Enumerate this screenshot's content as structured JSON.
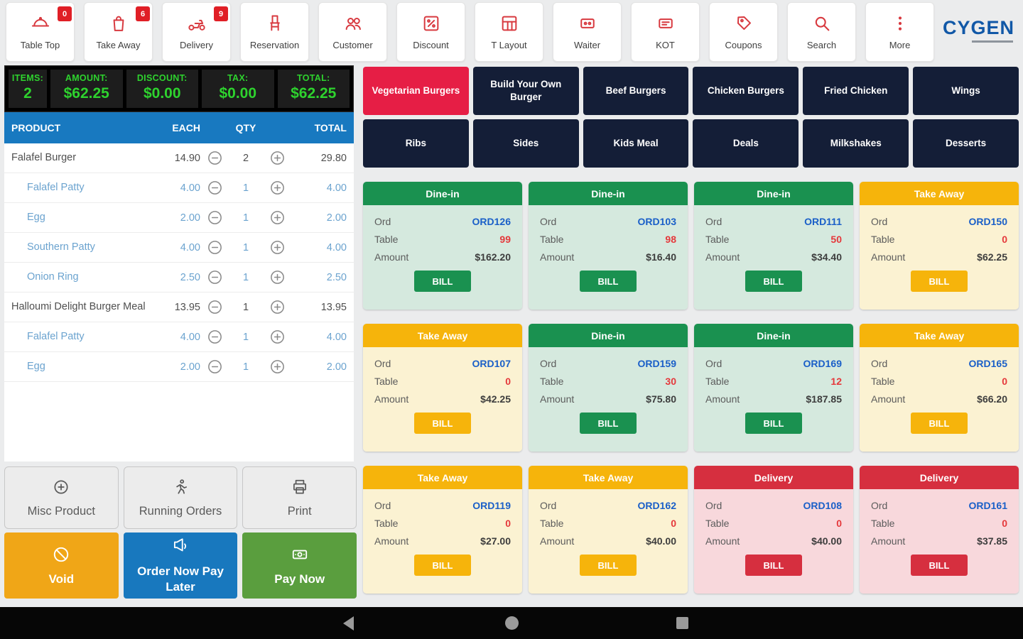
{
  "toolbar": {
    "brand": "CYGEN",
    "items": [
      {
        "label": "Table Top",
        "icon": "cloche-icon",
        "badge": "0"
      },
      {
        "label": "Take Away",
        "icon": "bag-icon",
        "badge": "6"
      },
      {
        "label": "Delivery",
        "icon": "scooter-icon",
        "badge": "9"
      },
      {
        "label": "Reservation",
        "icon": "chair-icon"
      },
      {
        "label": "Customer",
        "icon": "customers-icon"
      },
      {
        "label": "Discount",
        "icon": "discount-icon"
      },
      {
        "label": "T Layout",
        "icon": "table-layout-icon"
      },
      {
        "label": "Waiter",
        "icon": "waiter-pad-icon"
      },
      {
        "label": "KOT",
        "icon": "kot-ticket-icon"
      },
      {
        "label": "Coupons",
        "icon": "coupon-tag-icon"
      },
      {
        "label": "Search",
        "icon": "search-icon"
      },
      {
        "label": "More",
        "icon": "more-dots-icon"
      }
    ]
  },
  "summary": {
    "items": [
      {
        "label": "ITEMS:",
        "value": "2"
      },
      {
        "label": "AMOUNT:",
        "value": "$62.25"
      },
      {
        "label": "DISCOUNT:",
        "value": "$0.00"
      },
      {
        "label": "TAX:",
        "value": "$0.00"
      },
      {
        "label": "TOTAL:",
        "value": "$62.25"
      }
    ]
  },
  "order_table": {
    "headers": {
      "product": "PRODUCT",
      "each": "EACH",
      "qty": "QTY",
      "total": "TOTAL"
    },
    "rows": [
      {
        "name": "Falafel Burger",
        "each": "14.90",
        "qty": "2",
        "total": "29.80",
        "kind": "main"
      },
      {
        "name": "Falafel Patty",
        "each": "4.00",
        "qty": "1",
        "total": "4.00",
        "kind": "sub"
      },
      {
        "name": "Egg",
        "each": "2.00",
        "qty": "1",
        "total": "2.00",
        "kind": "sub"
      },
      {
        "name": "Southern Patty",
        "each": "4.00",
        "qty": "1",
        "total": "4.00",
        "kind": "sub"
      },
      {
        "name": "Onion Ring",
        "each": "2.50",
        "qty": "1",
        "total": "2.50",
        "kind": "sub"
      },
      {
        "name": "Halloumi Delight Burger Meal",
        "each": "13.95",
        "qty": "1",
        "total": "13.95",
        "kind": "main"
      },
      {
        "name": "Falafel Patty",
        "each": "4.00",
        "qty": "1",
        "total": "4.00",
        "kind": "sub"
      },
      {
        "name": "Egg",
        "each": "2.00",
        "qty": "1",
        "total": "2.00",
        "kind": "sub"
      }
    ]
  },
  "actions": {
    "misc_product": "Misc Product",
    "running_orders": "Running Orders",
    "print": "Print",
    "void": "Void",
    "order_now_pay_later": "Order Now Pay Later",
    "pay_now": "Pay Now"
  },
  "categories": [
    {
      "label": "Vegetarian Burgers",
      "active": "true"
    },
    {
      "label": "Build Your Own Burger"
    },
    {
      "label": "Beef Burgers"
    },
    {
      "label": "Chicken Burgers"
    },
    {
      "label": "Fried Chicken"
    },
    {
      "label": "Wings"
    },
    {
      "label": "Ribs"
    },
    {
      "label": "Sides"
    },
    {
      "label": "Kids Meal"
    },
    {
      "label": "Deals"
    },
    {
      "label": "Milkshakes"
    },
    {
      "label": "Desserts"
    }
  ],
  "order_cards": {
    "labels": {
      "ord": "Ord",
      "table": "Table",
      "amount": "Amount",
      "bill": "BILL"
    },
    "cards": [
      {
        "type": "dine-in",
        "label": "Dine-in",
        "ord": "ORD126",
        "table": "99",
        "amount": "$162.20"
      },
      {
        "type": "dine-in",
        "label": "Dine-in",
        "ord": "ORD103",
        "table": "98",
        "amount": "$16.40"
      },
      {
        "type": "dine-in",
        "label": "Dine-in",
        "ord": "ORD111",
        "table": "50",
        "amount": "$34.40"
      },
      {
        "type": "take-away",
        "label": "Take Away",
        "ord": "ORD150",
        "table": "0",
        "amount": "$62.25"
      },
      {
        "type": "take-away",
        "label": "Take Away",
        "ord": "ORD107",
        "table": "0",
        "amount": "$42.25"
      },
      {
        "type": "dine-in",
        "label": "Dine-in",
        "ord": "ORD159",
        "table": "30",
        "amount": "$75.80"
      },
      {
        "type": "dine-in",
        "label": "Dine-in",
        "ord": "ORD169",
        "table": "12",
        "amount": "$187.85"
      },
      {
        "type": "take-away",
        "label": "Take Away",
        "ord": "ORD165",
        "table": "0",
        "amount": "$66.20"
      },
      {
        "type": "take-away",
        "label": "Take Away",
        "ord": "ORD119",
        "table": "0",
        "amount": "$27.00"
      },
      {
        "type": "take-away",
        "label": "Take Away",
        "ord": "ORD162",
        "table": "0",
        "amount": "$40.00"
      },
      {
        "type": "delivery",
        "label": "Delivery",
        "ord": "ORD108",
        "table": "0",
        "amount": "$40.00"
      },
      {
        "type": "delivery",
        "label": "Delivery",
        "ord": "ORD161",
        "table": "0",
        "amount": "$37.85"
      }
    ]
  },
  "navbar": {
    "icons": [
      "back-icon",
      "home-icon",
      "recents-icon"
    ]
  },
  "colors": {
    "accent_red": "#e01f26",
    "category_active": "#e61e45",
    "category_dark": "#141e37",
    "dine_in": "#1a9150",
    "take_away": "#f6b40b",
    "delivery": "#d62f3f",
    "summary_green": "#2ed22e",
    "table_header_blue": "#1879c0",
    "brand_blue": "#1158a7"
  }
}
